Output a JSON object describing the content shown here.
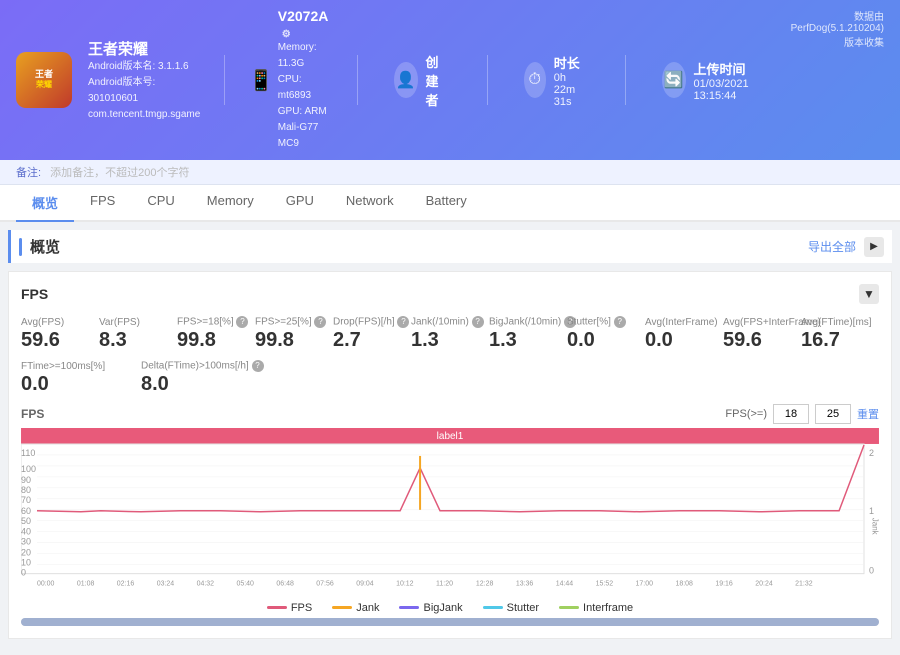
{
  "header": {
    "game_title": "王者荣耀",
    "android_version": "Android版本名: 3.1.1.6",
    "android_code": "Android版本号: 301010601",
    "package": "com.tencent.tmgp.sgame",
    "device_id": "V2072A",
    "memory": "Memory: 11.3G",
    "cpu": "CPU: mt6893",
    "gpu": "GPU: ARM Mali-G77 MC9",
    "creator_label": "创建者",
    "creator_icon": "👤",
    "duration_label": "时长",
    "duration_value": "0h 22m 31s",
    "upload_label": "上传时间",
    "upload_value": "01/03/2021 13:15:44",
    "data_source": "数据由PerfDog(5.1.210204)版本收集"
  },
  "notes": {
    "label": "备注:",
    "placeholder": "添加备注，不超过200个字符"
  },
  "nav": {
    "tabs": [
      "概览",
      "FPS",
      "CPU",
      "Memory",
      "GPU",
      "Network",
      "Battery"
    ],
    "active": 0
  },
  "overview": {
    "title": "概览",
    "export_label": "导出全部"
  },
  "fps_panel": {
    "title": "FPS",
    "stats": [
      {
        "label": "Avg(FPS)",
        "value": "59.6"
      },
      {
        "label": "Var(FPS)",
        "value": "8.3"
      },
      {
        "label": "FPS>=18[%]",
        "value": "99.8",
        "help": true
      },
      {
        "label": "FPS>=25[%]",
        "value": "99.8",
        "help": true
      },
      {
        "label": "Drop(FPS)[/h]",
        "value": "2.7",
        "help": true
      },
      {
        "label": "Jank(/10min)",
        "value": "1.3",
        "help": true
      },
      {
        "label": "BigJank(/10min)",
        "value": "1.3",
        "help": true
      },
      {
        "label": "Stutter[%]",
        "value": "0.0",
        "help": true
      },
      {
        "label": "Avg(InterFrame)",
        "value": "0.0"
      },
      {
        "label": "Avg(FPS+InterFrame)",
        "value": "59.6"
      },
      {
        "label": "Avg(FTime)[ms]",
        "value": "16.7"
      }
    ],
    "stats2": [
      {
        "label": "FTime>=100ms[%]",
        "value": "0.0"
      },
      {
        "label": "Delta(FTime)>100ms[/h]",
        "value": "8.0",
        "help": true
      }
    ],
    "chart_label": "FPS",
    "fps_threshold_label": "FPS(>=)",
    "fps_val1": "18",
    "fps_val2": "25",
    "reset_label": "重置",
    "chart_bar_label": "label1",
    "legend": [
      {
        "label": "FPS",
        "color": "#e05a7a"
      },
      {
        "label": "Jank",
        "color": "#f5a623"
      },
      {
        "label": "BigJank",
        "color": "#7b68ee"
      },
      {
        "label": "Stutter",
        "color": "#50c8e8"
      },
      {
        "label": "Interframe",
        "color": "#a0d060"
      }
    ],
    "x_labels": [
      "00:00",
      "01:08",
      "02:16",
      "03:24",
      "04:32",
      "05:40",
      "06:48",
      "07:56",
      "09:04",
      "10:12",
      "11:20",
      "12:28",
      "13:36",
      "14:44",
      "15:52",
      "17:00",
      "18:08",
      "19:16",
      "20:24",
      "21:32"
    ]
  }
}
